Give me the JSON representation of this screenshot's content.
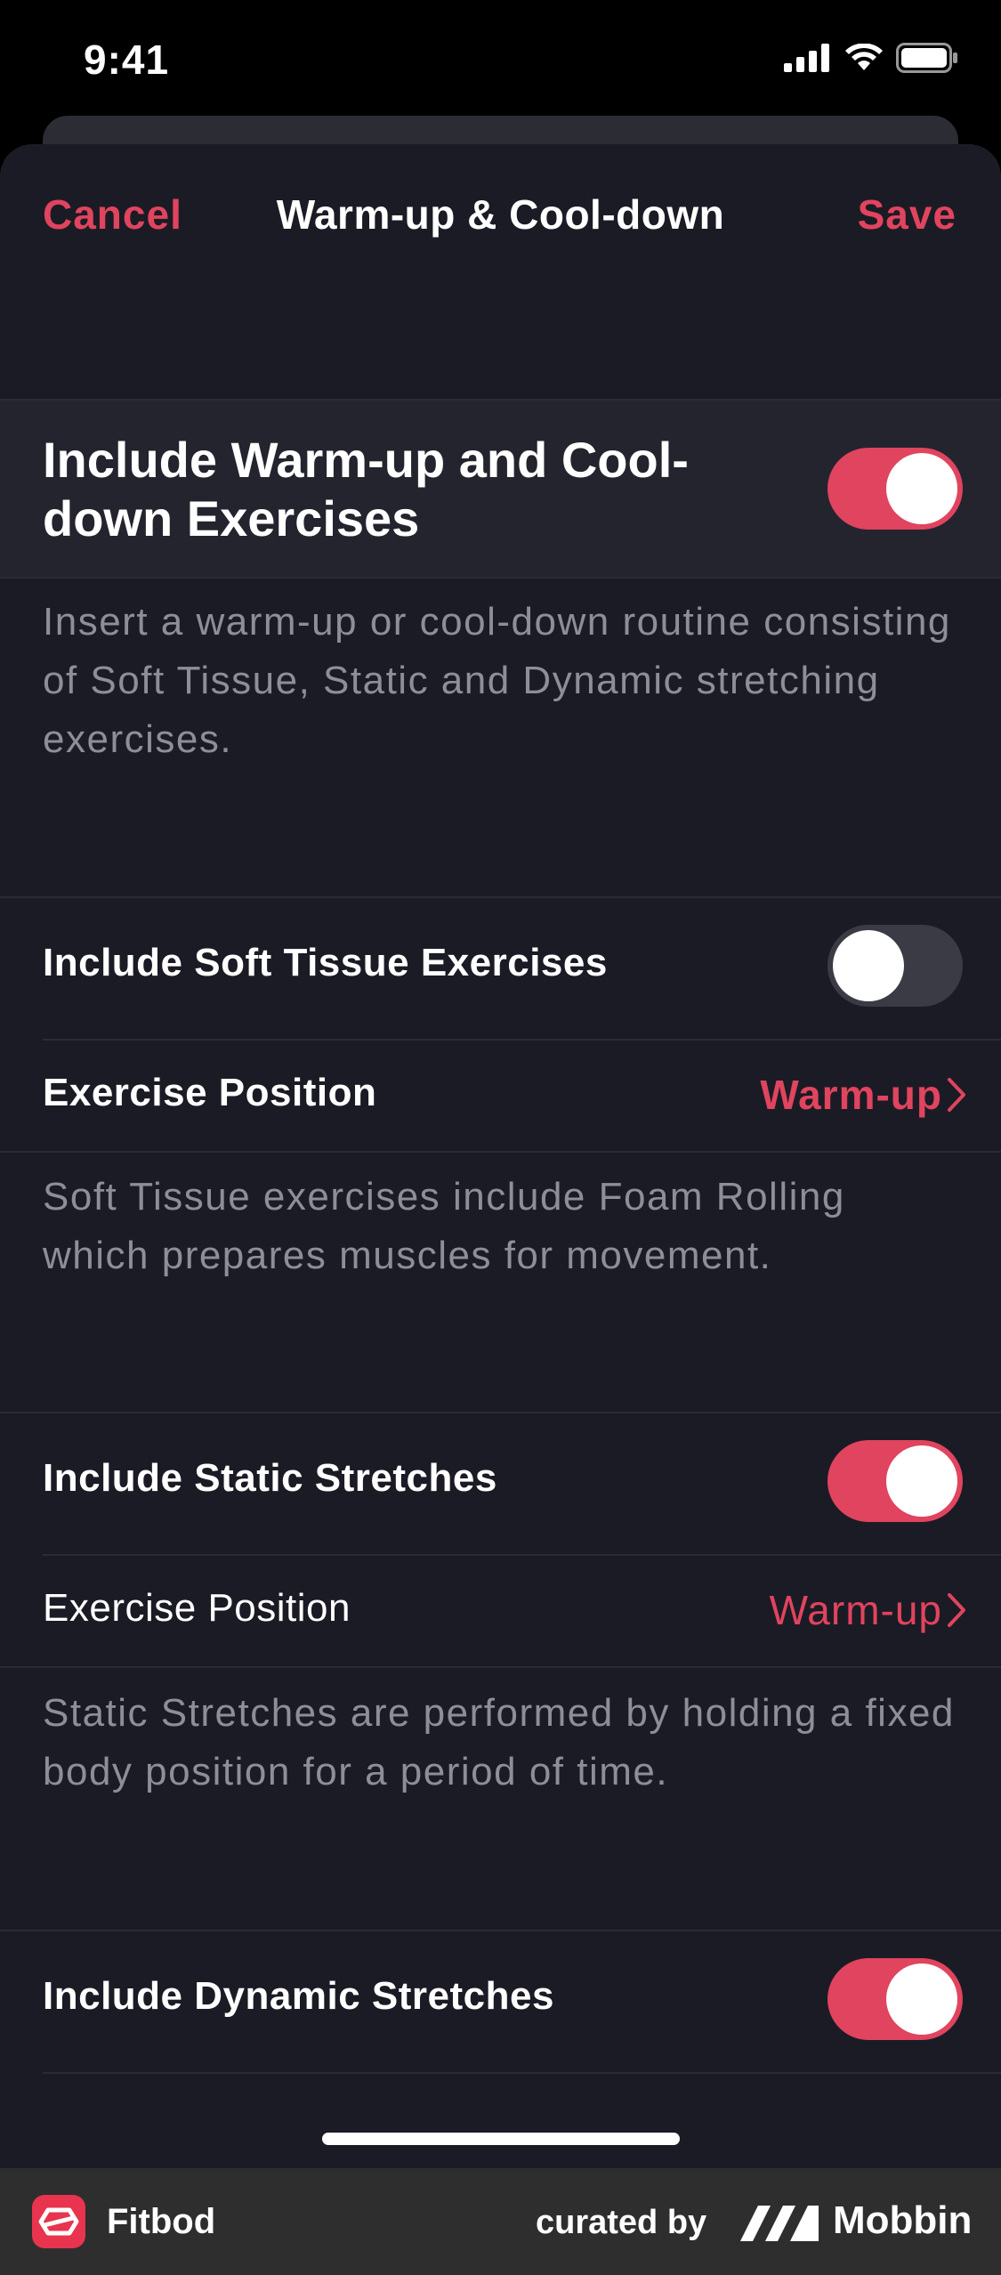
{
  "status_bar": {
    "time": "9:41"
  },
  "nav": {
    "cancel": "Cancel",
    "title": "Warm-up & Cool-down",
    "save": "Save"
  },
  "main_toggle": {
    "label": "Include Warm-up and Cool-down Exercises",
    "on": true,
    "description": "Insert a warm-up or cool-down routine consisting of Soft Tissue, Static and Dynamic stretching exercises."
  },
  "soft_tissue": {
    "label": "Include Soft Tissue Exercises",
    "on": false,
    "position_label": "Exercise Position",
    "position_value": "Warm-up",
    "description": "Soft Tissue exercises include Foam Rolling which prepares muscles for movement."
  },
  "static": {
    "label": "Include Static Stretches",
    "on": true,
    "position_label": "Exercise Position",
    "position_value": "Warm-up",
    "description": "Static Stretches are performed by holding a fixed body position for a period of time."
  },
  "dynamic": {
    "label": "Include Dynamic Stretches",
    "on": true
  },
  "footer": {
    "app_name": "Fitbod",
    "curated_by": "curated by",
    "brand": "Mobbin"
  },
  "colors": {
    "accent": "#e0445e",
    "background": "#1b1b25",
    "toggle_off": "#3a3b45"
  }
}
